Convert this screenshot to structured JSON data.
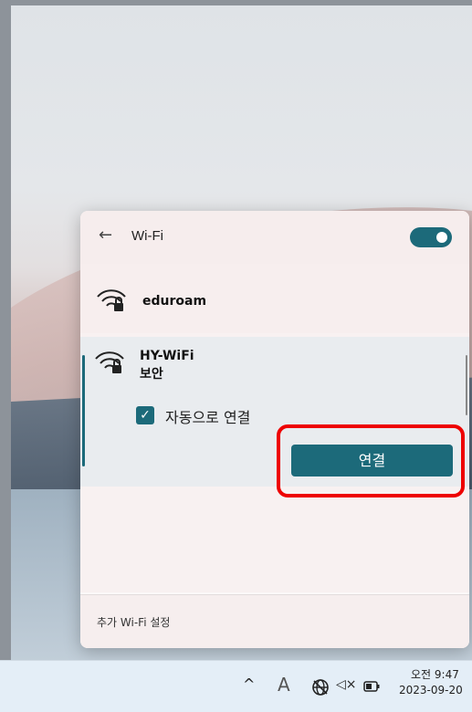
{
  "wifi_panel": {
    "title": "Wi-Fi",
    "toggle_on": true,
    "networks": [
      {
        "name": "eduroam",
        "icon": "wifi-secure-icon"
      },
      {
        "name": "HY-WiFi",
        "status": "보안",
        "icon": "wifi-secure-icon",
        "auto_connect_label": "자동으로 연결",
        "auto_connect_checked": true,
        "connect_label": "연결"
      }
    ],
    "footer_link": "추가 Wi-Fi 설정"
  },
  "taskbar": {
    "input_indicator": "A",
    "time": "오전 9:47",
    "date": "2023-09-20"
  },
  "colors": {
    "accent": "#1c6a7a",
    "highlight": "#ee0000"
  }
}
